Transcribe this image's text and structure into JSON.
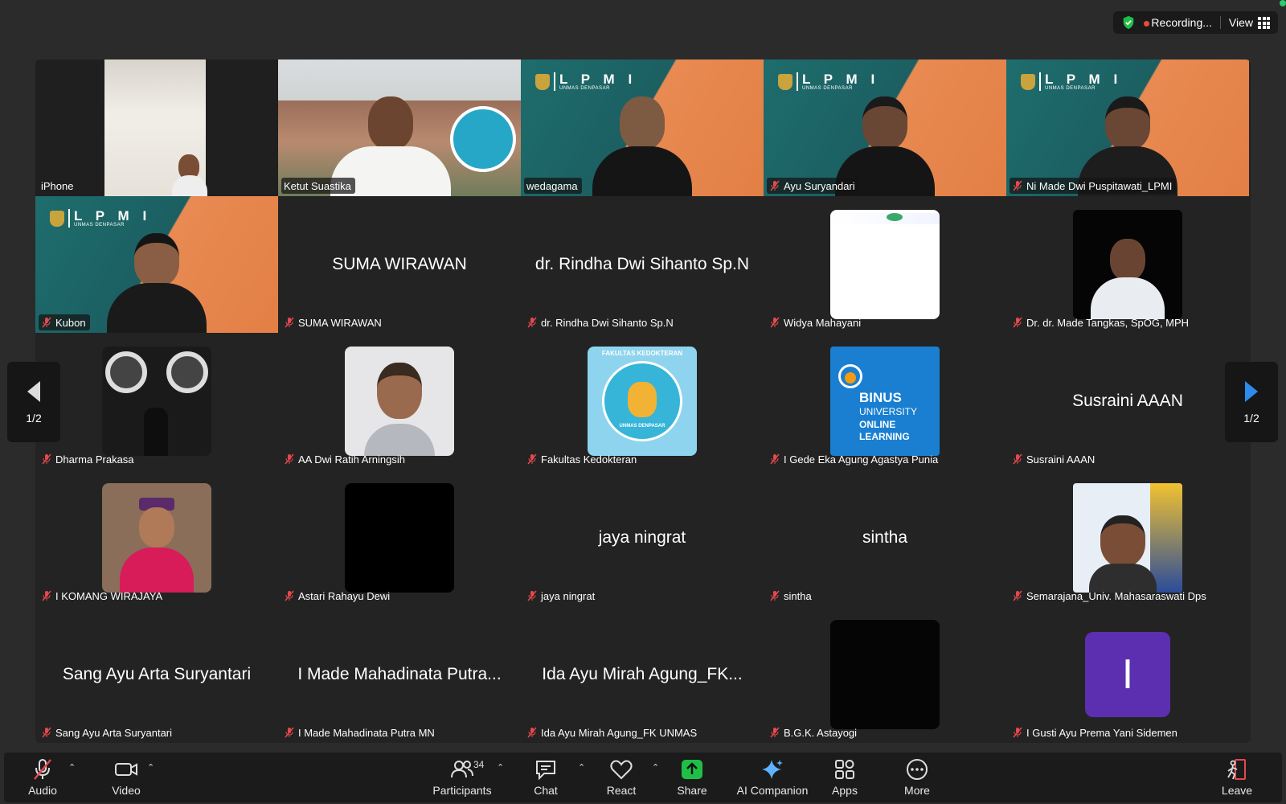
{
  "status": {
    "recording_label": "Recording...",
    "view_label": "View"
  },
  "pager": {
    "left_label": "1/2",
    "right_label": "1/2"
  },
  "participants": [
    {
      "name": "iPhone"
    },
    {
      "name": "Ketut Suastika"
    },
    {
      "name": "wedagama"
    },
    {
      "name": "Ayu Suryandari"
    },
    {
      "name": "Ni Made Dwi Puspitawati_LPMI"
    },
    {
      "name": "Kubon"
    },
    {
      "name": "SUMA WIRAWAN"
    },
    {
      "name": "dr. Rindha Dwi Sihanto Sp.N"
    },
    {
      "name": "Widya Mahayani"
    },
    {
      "name": "Dr. dr. Made Tangkas, SpOG, MPH"
    },
    {
      "name": "Dharma Prakasa"
    },
    {
      "name": "AA Dwi Ratih Arningsih"
    },
    {
      "name": "Fakultas Kedokteran"
    },
    {
      "name": "I Gede Eka Agung Agastya Punia"
    },
    {
      "name": "Susraini AAAN"
    },
    {
      "name": "I KOMANG WIRAJAYA"
    },
    {
      "name": "Astari Rahayu Dewi"
    },
    {
      "name": "jaya ningrat"
    },
    {
      "name": "sintha"
    },
    {
      "name": "Semarajana_Univ. Mahasaraswati Dps"
    },
    {
      "name": "Sang Ayu Arta Suryantari",
      "display": "Sang Ayu Arta Suryantari"
    },
    {
      "name": "I Made Mahadinata Putra MN",
      "display": "I Made Mahadinata Putra..."
    },
    {
      "name": "Ida Ayu Mirah Agung_FK UNMAS",
      "display": "Ida Ayu Mirah Agung_FK..."
    },
    {
      "name": "B.G.K. Astayogi"
    },
    {
      "name": "I Gusti Ayu Prema Yani Sidemen",
      "avatar_letter": "I"
    }
  ],
  "tile_text": {
    "lpmi_big": "L P M I",
    "lpmi_small": "UNMAS DENPASAR",
    "binus_1": "BINUS",
    "binus_2": "UNIVERSITY",
    "binus_3": "ONLINE",
    "binus_4": "LEARNING",
    "fk_ring": "FAKULTAS KEDOKTERAN",
    "fk_bottom": "UNMAS DENPASAR"
  },
  "toolbar": {
    "audio": "Audio",
    "video": "Video",
    "participants": "Participants",
    "participants_count": "34",
    "chat": "Chat",
    "react": "React",
    "share": "Share",
    "ai_companion": "AI Companion",
    "apps": "Apps",
    "more": "More",
    "leave": "Leave"
  },
  "colors": {
    "active_speaker_border": "#2ddb57",
    "share_green": "#1fbf47",
    "avatar_purple": "#5b2fb0",
    "mute_red": "#e5484d",
    "binus_blue": "#1a7fd1"
  }
}
